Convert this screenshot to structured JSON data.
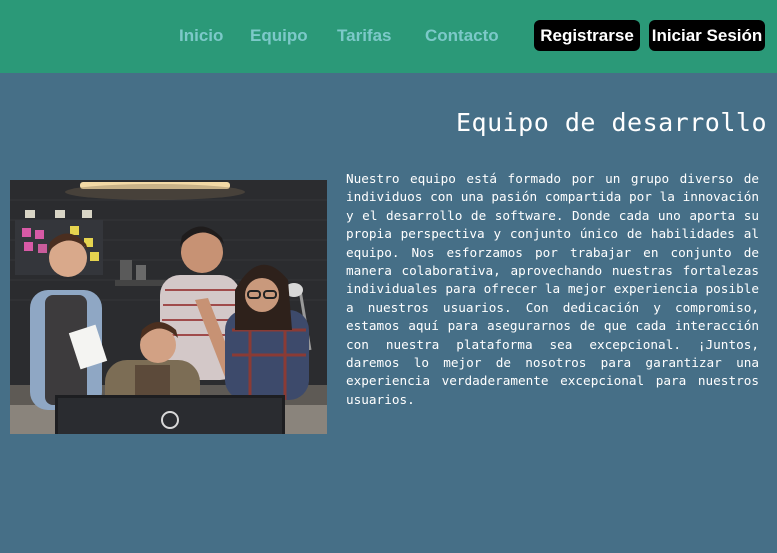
{
  "nav": {
    "links": [
      "Inicio",
      "Equipo",
      "Tarifas",
      "Contacto"
    ],
    "register_label": "Registrarse",
    "login_label": "Iniciar Sesión"
  },
  "main": {
    "title": "Equipo de desarrollo",
    "description": "Nuestro equipo está formado por un grupo diverso de individuos con una pasión compartida por la innovación y el desarrollo de software. Donde cada uno aporta su propia perspectiva y conjunto único de habilidades al equipo. Nos esforzamos por trabajar en conjunto de manera colaborativa, aprovechando nuestras fortalezas individuales para ofrecer la mejor experiencia posible a nuestros usuarios. Con dedicación y compromiso, estamos aquí para asegurarnos de que cada interacción con nuestra plataforma sea excepcional. ¡Juntos, daremos lo mejor de nosotros para garantizar una experiencia verdaderamente excepcional para nuestros usuarios."
  },
  "colors": {
    "navbar": "#2b9978",
    "nav_link": "#7cc9c9",
    "page_background": "#466f87",
    "button_background": "#000000"
  }
}
